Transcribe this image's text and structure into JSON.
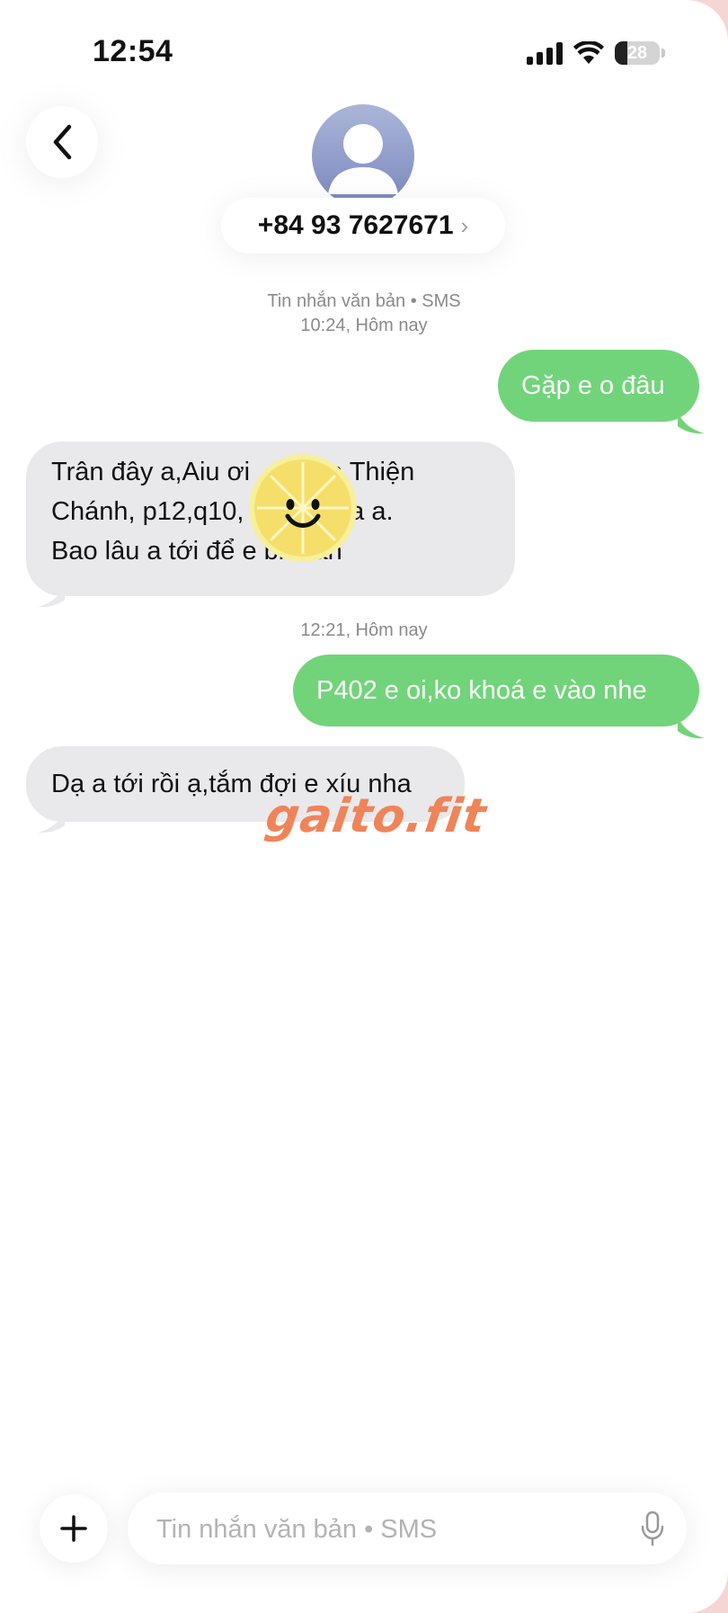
{
  "status_bar": {
    "time": "12:54",
    "battery_level": "28"
  },
  "header": {
    "contact_number": "+84 93 7627671",
    "icons": [
      "chevron-left-icon",
      "person-avatar-icon",
      "chevron-right-icon"
    ]
  },
  "thread": {
    "meta_1_line1": "Tin nhắn văn bản • SMS",
    "meta_1_line2": "10:24, Hôm nay",
    "msg_1_out": "Gặp e o đâu",
    "msg_2_in_line1": "Trân đây a,Aiu ơi … Trần Thiện",
    "msg_2_in_line2": "Chánh, p12,q10, … nh nha a.",
    "msg_2_in_line3": "Bao lâu a tới để e biết ah",
    "meta_2": "12:21, Hôm nay",
    "msg_3_out": "P402 e oi,ko khoá e vào nhe",
    "msg_4_in": "Dạ a tới rồi ạ,tắm đợi e xíu nha"
  },
  "watermark": {
    "text": "gaito.fit"
  },
  "composer": {
    "placeholder": "Tin nhắn văn bản • SMS",
    "value": ""
  },
  "colors": {
    "outgoing_bubble": "#72d47a",
    "incoming_bubble": "#e9e9eb",
    "watermark": "#ef8459",
    "background_edge": "#f6d6d4"
  }
}
